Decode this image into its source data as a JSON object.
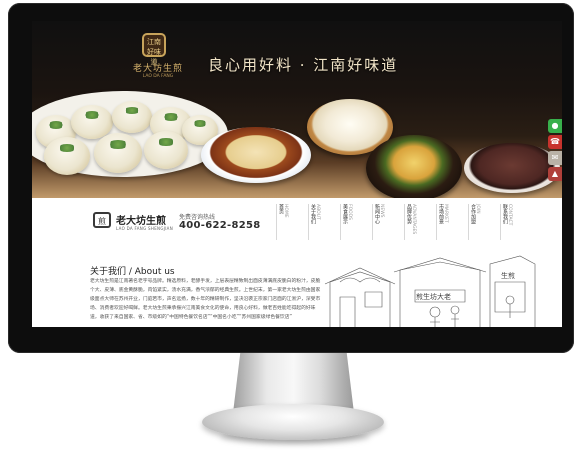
{
  "hero": {
    "logo_seal": "江南好味道",
    "logo_name": "老大坊生煎",
    "logo_sub": "LAO DA FANG",
    "slogan": "良心用好料 · 江南好味道"
  },
  "side_tabs": [
    "",
    "",
    "",
    ""
  ],
  "nav": {
    "brand_logo": "煎",
    "brand_name": "老大坊生煎",
    "brand_en": "LAO DA FANG SHENGJIAN",
    "hotline_label": "免费咨询热线",
    "hotline": "400-622-8258",
    "menu": [
      {
        "zh": "首页",
        "en": "HOME"
      },
      {
        "zh": "关于我们",
        "en": "ABOUT"
      },
      {
        "zh": "美食展示",
        "en": "FOODS"
      },
      {
        "zh": "新闻中心",
        "en": "NEWS"
      },
      {
        "zh": "品牌优势",
        "en": "ADVANTAGES"
      },
      {
        "zh": "市场前景",
        "en": "MARKET"
      },
      {
        "zh": "合作加盟",
        "en": "JOIN"
      },
      {
        "zh": "联系我们",
        "en": "CONTACT"
      }
    ]
  },
  "about": {
    "title": "关于我们 / About us",
    "text": "老大坊生煎是江南著名老字号品牌。精选原料，老酵手发，上层表层精致制出面皮薄满底皮脆白的粉汁，皮脆个大、皮薄、底金黄酥脆，肉馅紧实，汤水充满，香气浓郁的经典生煎。上世纪末，第一家老大坊生煎由国家级面点大师在苏州开业，门庭若市，声名远扬，数十年的精研制作，坚决沿袭正宗家门店面的江浙沪，深受市场、消费者欢迎好喝鲜。老大坊生煎秉承振兴江南美食文化的使命，用良心好料，做老百姓能吃得起的好味道，收获了来自国家、省、市级如的“中国特色餐饮名店”“中国名小吃”“苏州国家级绿色餐饮店”"
  },
  "sketch": {
    "sign1": "煎生坊大老",
    "sign2": "生煎"
  }
}
